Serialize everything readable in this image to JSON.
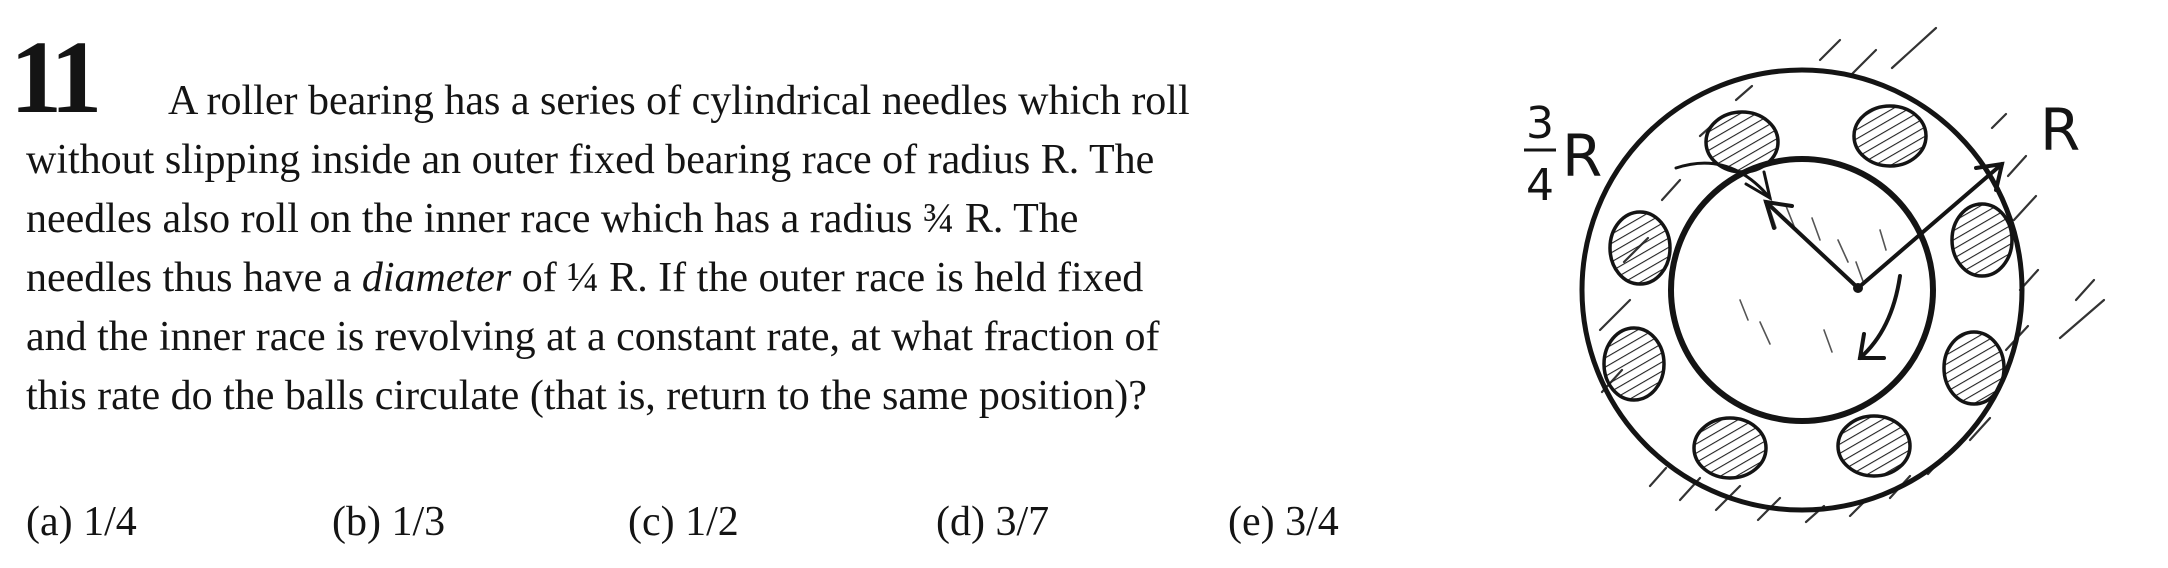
{
  "problem": {
    "number": "11",
    "lines": [
      "A roller bearing has a series of cylindrical needles which roll",
      "without slipping inside an outer fixed bearing race of radius R.  The",
      "needles also roll on the inner race which has a radius  ¾ R.  The",
      "If the outer race is held fixed",
      "and the inner race is revolving at a constant rate, at what fraction of",
      "this rate do the balls circulate (that is, return to the same position)?"
    ],
    "line4_prefix": "needles thus have a ",
    "line4_italic": "diameter",
    "line4_mid": " of  ¼ R.  "
  },
  "choices": [
    {
      "label": "(a) 1/4"
    },
    {
      "label": "(b) 1/3"
    },
    {
      "label": "(c) 1/2"
    },
    {
      "label": "(d) 3/7"
    },
    {
      "label": "(e) 3/4"
    }
  ],
  "figure": {
    "label_outer_radius": "R",
    "label_inner_num": "3",
    "label_inner_den": "4",
    "label_inner_r": "R"
  }
}
